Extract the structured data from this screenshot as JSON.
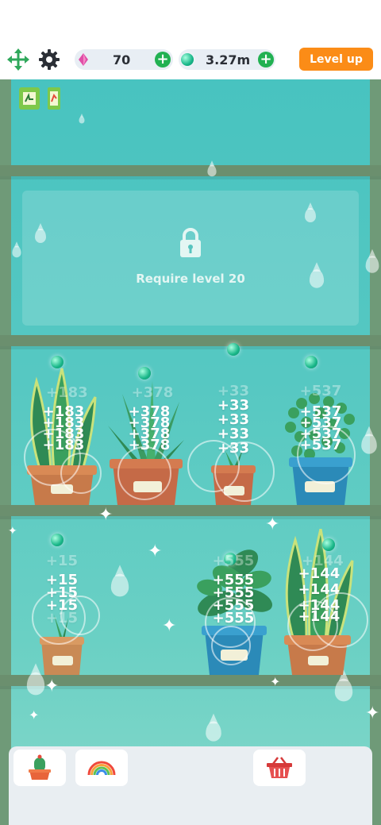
{
  "topbar": {
    "move_icon": "move-arrows-icon",
    "settings_icon": "gear-icon",
    "gems": {
      "value": "70",
      "icon": "pink-gem-icon"
    },
    "coins": {
      "value": "3.27m",
      "icon": "green-orb-icon"
    },
    "level_up_label": "Level up",
    "colors": {
      "accent": "#fb8c17",
      "plus": "#22b152"
    }
  },
  "locked_shelf": {
    "text": "Require level 20",
    "icon": "lock-icon"
  },
  "plants": [
    {
      "name": "snake-plant",
      "gains": [
        "+183",
        "+183",
        "+183",
        "+183"
      ],
      "faded": "+183"
    },
    {
      "name": "aloe",
      "gains": [
        "+378",
        "+378",
        "+378",
        "+378"
      ],
      "faded": "+378"
    },
    {
      "name": "small-sprout",
      "gains": [
        "+33",
        "+33",
        "+33",
        "+33"
      ],
      "faded": "+33"
    },
    {
      "name": "round-leaf",
      "gains": [
        "+537",
        "+537",
        "+537",
        "+537"
      ],
      "faded": "+537"
    },
    {
      "name": "grass-sprout",
      "gains": [
        "+15",
        "+15",
        "+15",
        "+15"
      ],
      "faded": "+15"
    },
    {
      "name": "rubber-plant",
      "gains": [
        "+555",
        "+555",
        "+555",
        "+555"
      ],
      "faded": "+555"
    },
    {
      "name": "tall-snake-plant",
      "gains": [
        "+144",
        "+144",
        "+144",
        "+144"
      ],
      "faded": "+144"
    }
  ],
  "bottom_bar": {
    "items": [
      "cactus-pot-icon",
      "rainbow-icon",
      "basket-icon"
    ]
  }
}
